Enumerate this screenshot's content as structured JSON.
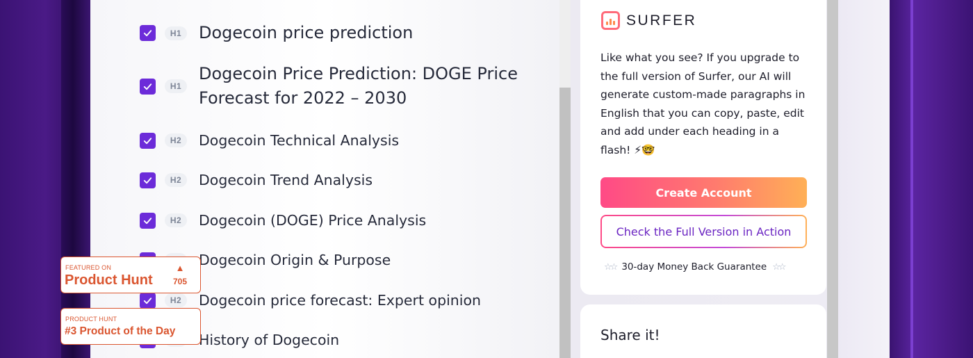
{
  "headings": [
    {
      "level": "H1",
      "text": "Dogecoin price prediction",
      "checked": true
    },
    {
      "level": "H1",
      "text": "Dogecoin Price Prediction: DOGE Price Forecast for 2022 – 2030",
      "checked": true
    },
    {
      "level": "H2",
      "text": "Dogecoin Technical Analysis",
      "checked": true
    },
    {
      "level": "H2",
      "text": "Dogecoin Trend Analysis",
      "checked": true
    },
    {
      "level": "H2",
      "text": "Dogecoin (DOGE) Price Analysis",
      "checked": true
    },
    {
      "level": "H2",
      "text": "Dogecoin Origin & Purpose",
      "checked": true
    },
    {
      "level": "H2",
      "text": "Dogecoin price forecast: Expert opinion",
      "checked": true
    },
    {
      "level": "H2",
      "text": "History of Dogecoin",
      "checked": true
    }
  ],
  "sidebar": {
    "logo_text": "SURFER",
    "promo_text": "Like what you see? If you upgrade to the full version of Surfer, our AI will generate custom-made paragraphs in English that you can copy, paste, edit and add under each heading in a flash! ⚡🤓",
    "create_account_label": "Create Account",
    "check_full_version_label": "Check the Full Version in Action",
    "guarantee_text": "30-day Money Back Guarantee",
    "share_title": "Share it!"
  },
  "product_hunt": {
    "featured_small": "FEATURED ON",
    "featured_big": "Product Hunt",
    "votes": "705",
    "day_small": "PRODUCT HUNT",
    "day_big": "#3 Product of the Day"
  },
  "colors": {
    "checkbox": "#6c2bd9",
    "accent_pink": "#ff4a86",
    "accent_orange": "#ffb056",
    "product_hunt": "#da552f",
    "page_purple": "#4a1d84"
  },
  "icons": {
    "check": "check-icon",
    "logo": "surfer-logo-icon",
    "upvote": "upvote-arrow-icon",
    "star": "star-icon"
  }
}
